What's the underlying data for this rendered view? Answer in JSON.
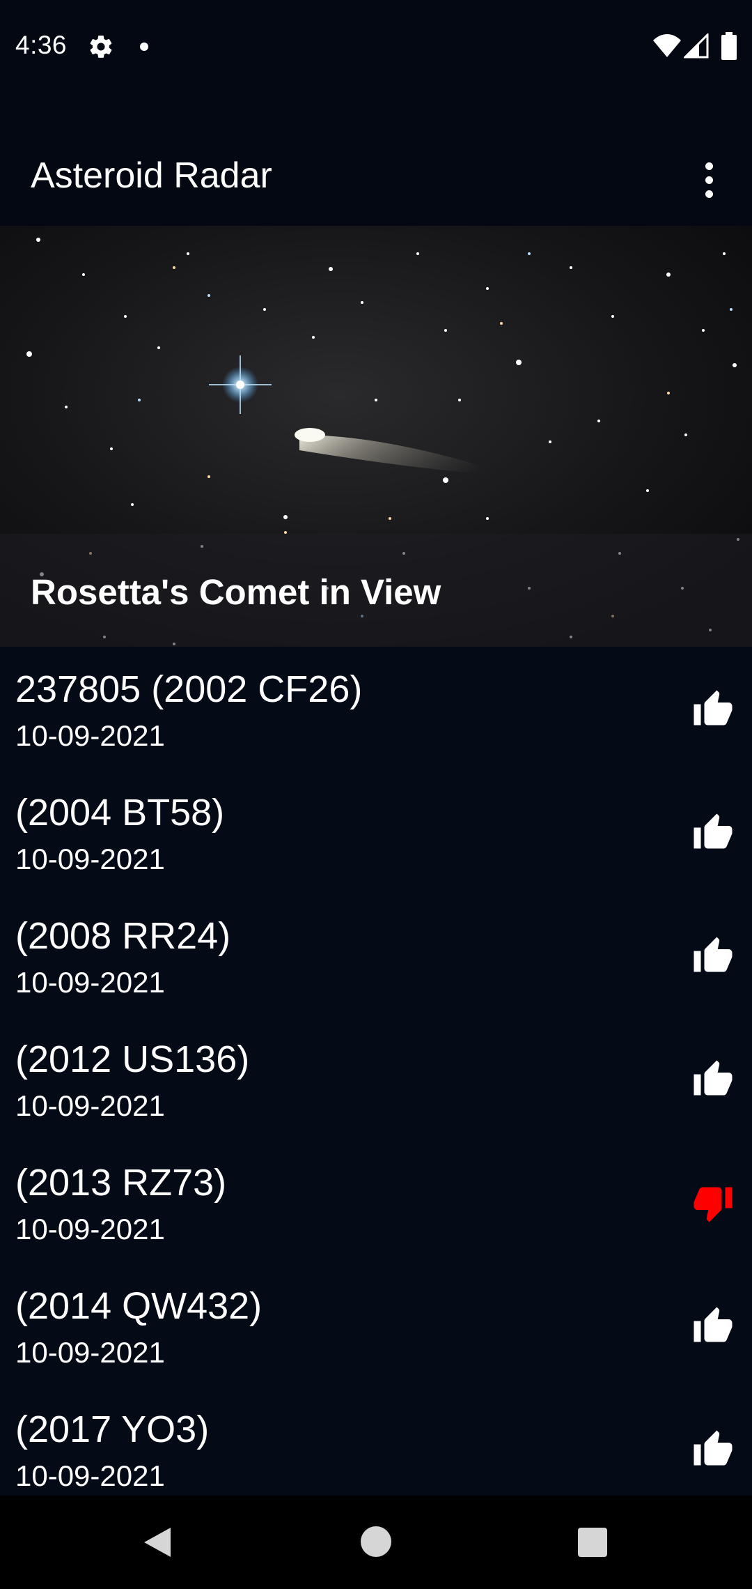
{
  "status_bar": {
    "time": "4:36",
    "icons": [
      "gear-icon",
      "notification-dot-icon",
      "wifi-icon",
      "signal-icon",
      "battery-icon"
    ]
  },
  "app_bar": {
    "title": "Asteroid Radar",
    "menu_icon": "more-vert-icon"
  },
  "picture_of_day": {
    "caption": "Rosetta's Comet in View"
  },
  "asteroids": [
    {
      "name": "237805 (2002 CF26)",
      "date": "10-09-2021",
      "hazardous": false,
      "icon": "thumbs-up-icon"
    },
    {
      "name": "(2004 BT58)",
      "date": "10-09-2021",
      "hazardous": false,
      "icon": "thumbs-up-icon"
    },
    {
      "name": "(2008 RR24)",
      "date": "10-09-2021",
      "hazardous": false,
      "icon": "thumbs-up-icon"
    },
    {
      "name": "(2012 US136)",
      "date": "10-09-2021",
      "hazardous": false,
      "icon": "thumbs-up-icon"
    },
    {
      "name": "(2013 RZ73)",
      "date": "10-09-2021",
      "hazardous": true,
      "icon": "thumbs-down-icon"
    },
    {
      "name": "(2014 QW432)",
      "date": "10-09-2021",
      "hazardous": false,
      "icon": "thumbs-up-icon"
    },
    {
      "name": "(2017 YO3)",
      "date": "10-09-2021",
      "hazardous": false,
      "icon": "thumbs-up-icon"
    }
  ],
  "colors": {
    "background": "#050a17",
    "safe_icon": "#ffffff",
    "hazard_icon": "#ff0000"
  },
  "nav_bar": {
    "buttons": [
      "back-icon",
      "home-icon",
      "recents-icon"
    ]
  }
}
